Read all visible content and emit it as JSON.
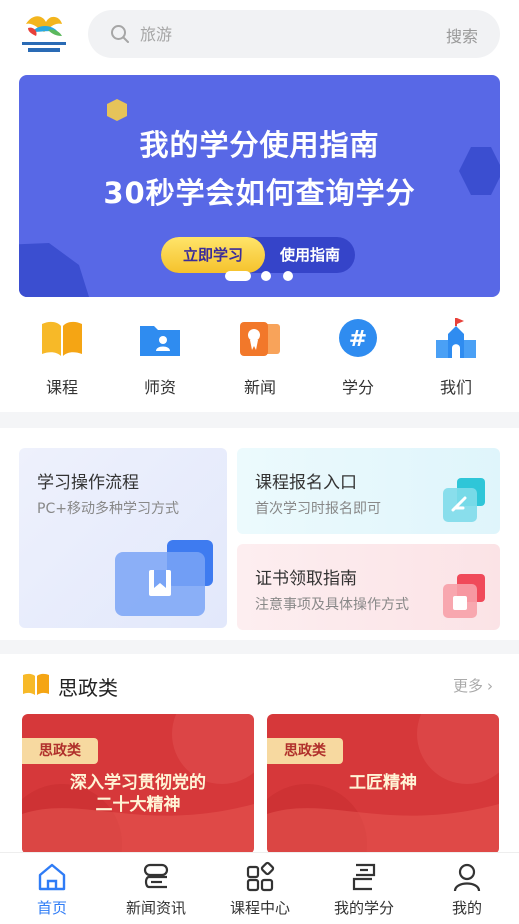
{
  "header": {
    "search_placeholder": "旅游",
    "search_button": "搜索"
  },
  "banner": {
    "title_line1": "我的学分使用指南",
    "title_line2": "30秒学会如何查询学分",
    "primary_button": "立即学习",
    "secondary_button": "使用指南",
    "active_slide": 1,
    "slide_count": 3
  },
  "quick_nav": [
    {
      "label": "课程",
      "icon": "book-icon"
    },
    {
      "label": "师资",
      "icon": "teacher-folder-icon"
    },
    {
      "label": "新闻",
      "icon": "news-icon"
    },
    {
      "label": "学分",
      "icon": "credit-icon"
    },
    {
      "label": "我们",
      "icon": "building-icon"
    }
  ],
  "cards": {
    "process": {
      "title": "学习操作流程",
      "subtitle": "PC+移动多种学习方式"
    },
    "enroll": {
      "title": "课程报名入口",
      "subtitle": "首次学习时报名即可"
    },
    "certificate": {
      "title": "证书领取指南",
      "subtitle": "注意事项及具体操作方式"
    }
  },
  "section": {
    "title": "思政类",
    "more": "更多",
    "courses": [
      {
        "tag": "思政类",
        "title_line1": "深入学习贯彻党的",
        "title_line2": "二十大精神"
      },
      {
        "tag": "思政类",
        "title_line1": "工匠精神",
        "title_line2": ""
      }
    ]
  },
  "tabbar": [
    {
      "label": "首页",
      "icon": "home-icon",
      "active": true
    },
    {
      "label": "新闻资讯",
      "icon": "news-tab-icon",
      "active": false
    },
    {
      "label": "课程中心",
      "icon": "grid-icon",
      "active": false
    },
    {
      "label": "我的学分",
      "icon": "credit-tab-icon",
      "active": false
    },
    {
      "label": "我的",
      "icon": "person-icon",
      "active": false
    }
  ],
  "colors": {
    "accent": "#2f7cf6",
    "banner": "#5868e6",
    "course_red": "#d6383a"
  }
}
